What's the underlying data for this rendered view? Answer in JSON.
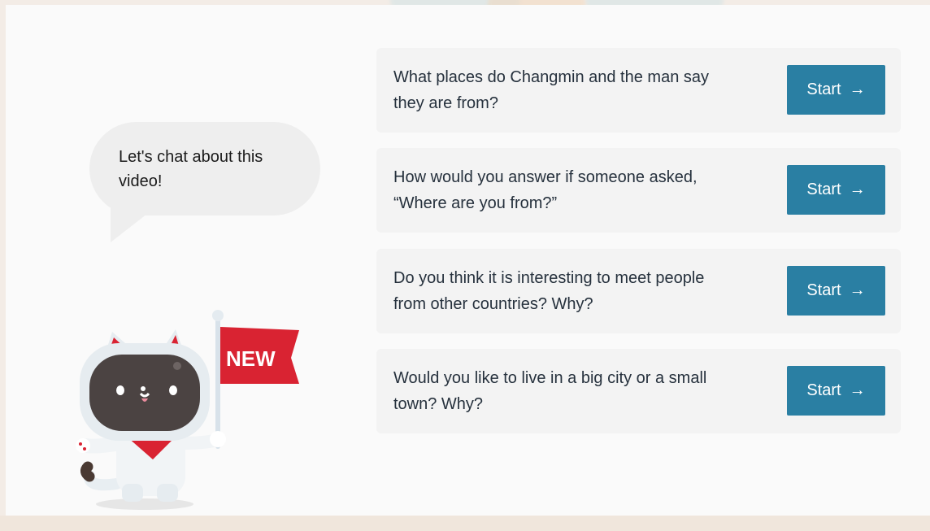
{
  "theme": {
    "accent": "#2a7fa3",
    "flag": "#d92332",
    "panel_bg": "#fafafa"
  },
  "bubble": {
    "text": "Let's chat about this video!"
  },
  "mascot": {
    "flag_label": "NEW"
  },
  "questions": [
    {
      "text": "What places do Changmin and the man say they are from?",
      "button_label": "Start",
      "button_icon": "arrow-right-icon"
    },
    {
      "text": "How would you answer if someone asked, “Where are you from?”",
      "button_label": "Start",
      "button_icon": "arrow-right-icon"
    },
    {
      "text": "Do you think it is interesting to meet people from other countries? Why?",
      "button_label": "Start",
      "button_icon": "arrow-right-icon"
    },
    {
      "text": "Would you like to live in a big city or a small town? Why?",
      "button_label": "Start",
      "button_icon": "arrow-right-icon"
    }
  ]
}
